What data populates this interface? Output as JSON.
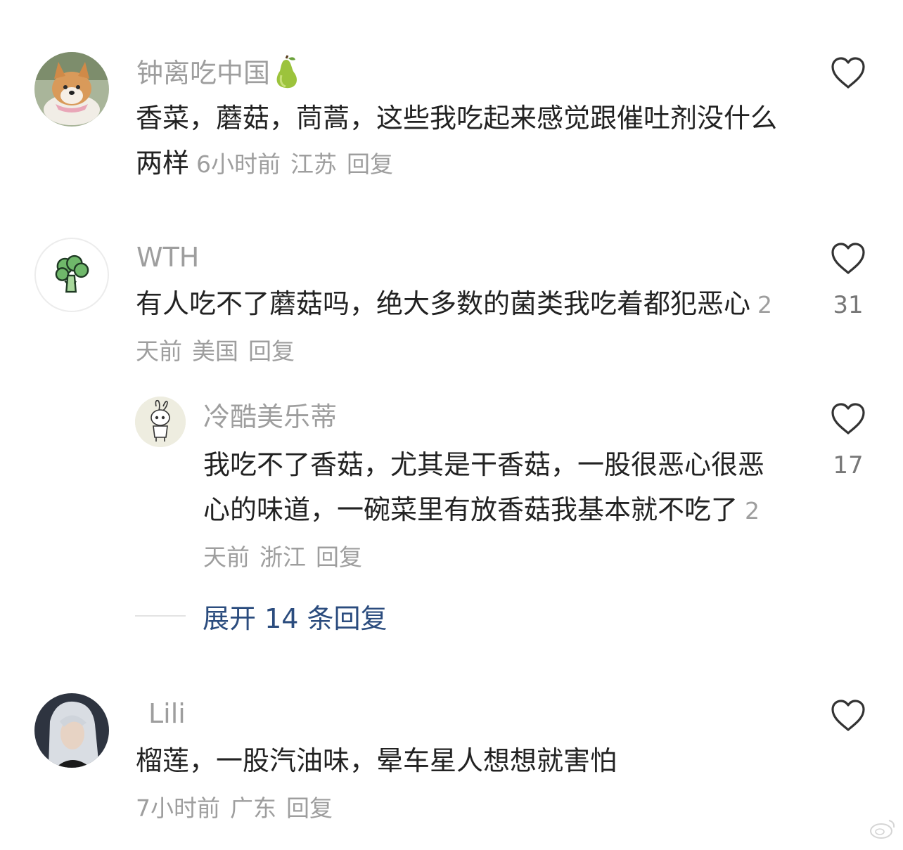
{
  "comments": [
    {
      "user": "钟离吃中国",
      "badge": "pear",
      "text": "香菜，蘑菇，茼蒿，这些我吃起来感觉跟催吐剂没什么两样",
      "time": "6小时前",
      "location": "江苏",
      "reply_label": "回复",
      "likes": ""
    },
    {
      "user": "WTH",
      "text": "有人吃不了蘑菇吗，绝大多数的菌类我吃着都犯恶心",
      "time": "2天前",
      "location": "美国",
      "reply_label": "回复",
      "likes": "31",
      "replies": [
        {
          "user": "冷酷美乐蒂",
          "text": "我吃不了香菇，尤其是干香菇，一股很恶心很恶心的味道，一碗菜里有放香菇我基本就不吃了",
          "time": "2天前",
          "location": "浙江",
          "reply_label": "回复",
          "likes": "17"
        }
      ],
      "expand_label": "展开 14 条回复"
    },
    {
      "user": "Lili",
      "text": "榴莲，一股汽油味，晕车星人想想就害怕",
      "time": "7小时前",
      "location": "广东",
      "reply_label": "回复",
      "likes": ""
    }
  ],
  "colors": {
    "username": "#9e9e9e",
    "text": "#222222",
    "link": "#2b4c7e"
  }
}
